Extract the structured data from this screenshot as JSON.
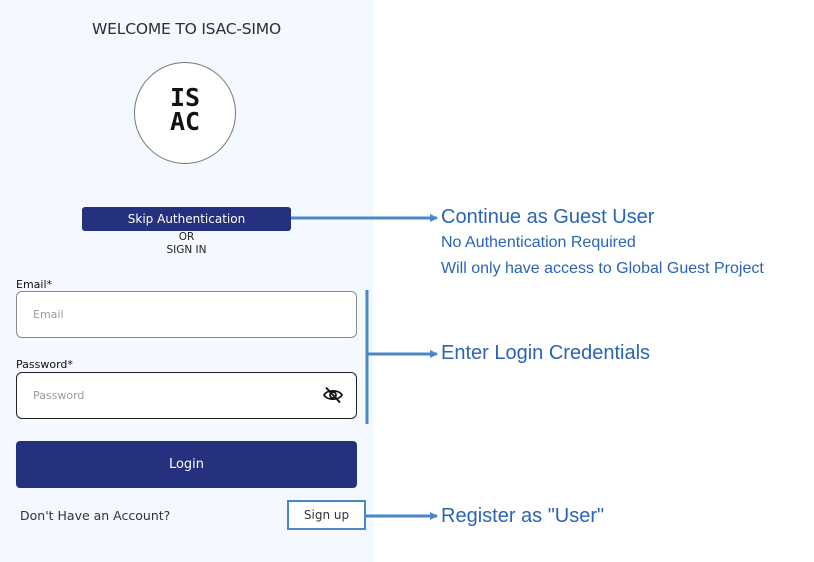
{
  "screen": {
    "title": "WELCOME TO ISAC-SIMO",
    "logo_lines": [
      "IS",
      "AC"
    ],
    "skip_button": "Skip Authentication",
    "or_text": "OR",
    "signin_text": "SIGN IN",
    "email": {
      "label": "Email*",
      "placeholder": "Email",
      "value": ""
    },
    "password": {
      "label": "Password*",
      "placeholder": "Password",
      "value": "",
      "toggle_icon": "eye-slash-icon"
    },
    "login_button": "Login",
    "no_account_text": "Don't Have an Account?",
    "signup_button": "Sign up"
  },
  "annotations": {
    "guest": {
      "title": "Continue as Guest User",
      "lines": [
        "No Authentication Required",
        "Will only have access to Global Guest Project"
      ]
    },
    "credentials": {
      "title": "Enter Login Credentials"
    },
    "register": {
      "title": "Register as \"User\""
    }
  },
  "colors": {
    "primary_button": "#25307f",
    "annotation": "#2a64b8",
    "annotation_arrow": "#4a86c8",
    "screen_background": "#f3f9fe"
  }
}
